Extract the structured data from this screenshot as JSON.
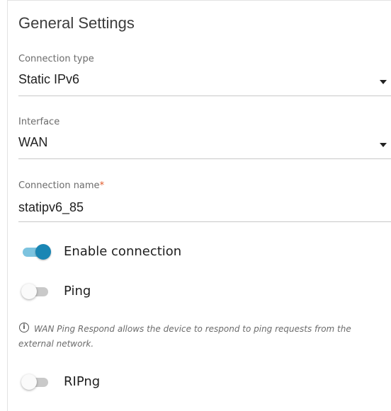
{
  "section": {
    "title": "General Settings"
  },
  "connection_type": {
    "label": "Connection type",
    "value": "Static IPv6"
  },
  "interface": {
    "label": "Interface",
    "value": "WAN"
  },
  "connection_name": {
    "label": "Connection name",
    "required_mark": "*",
    "value": "statipv6_85"
  },
  "toggles": {
    "enable_connection": {
      "label": "Enable connection",
      "on": true
    },
    "ping": {
      "label": "Ping",
      "on": false
    },
    "ripng": {
      "label": "RIPng",
      "on": false
    }
  },
  "info": {
    "icon": "info-icon",
    "text": "WAN Ping Respond allows the device to respond to ping requests from the external network."
  },
  "colors": {
    "accent": "#1a86b4",
    "accent_track": "#7cc3df",
    "required": "#e05a2a"
  }
}
